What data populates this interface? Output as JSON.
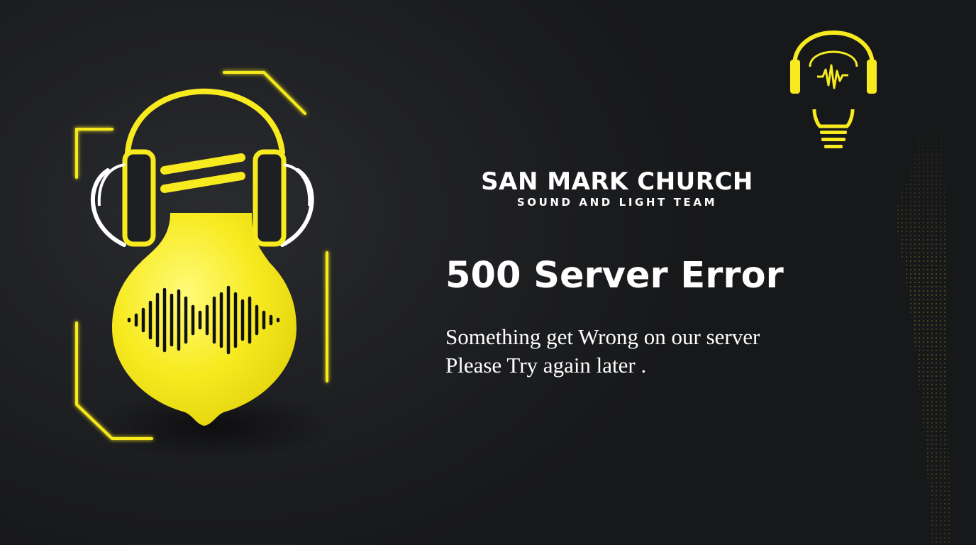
{
  "brand": {
    "name": "SAN MARK CHURCH",
    "subtitle": "SOUND AND LIGHT TEAM"
  },
  "error": {
    "title": "500 Server Error",
    "line1": "Something get Wrong on our server",
    "line2": "Please Try again later ."
  },
  "icons": {
    "hero": "headphones-lightbulb-icon",
    "corner": "headphones-lightbulb-logo-icon"
  },
  "colors": {
    "accent": "#f7ea1f",
    "background": "#1e1f22",
    "text": "#ffffff"
  }
}
